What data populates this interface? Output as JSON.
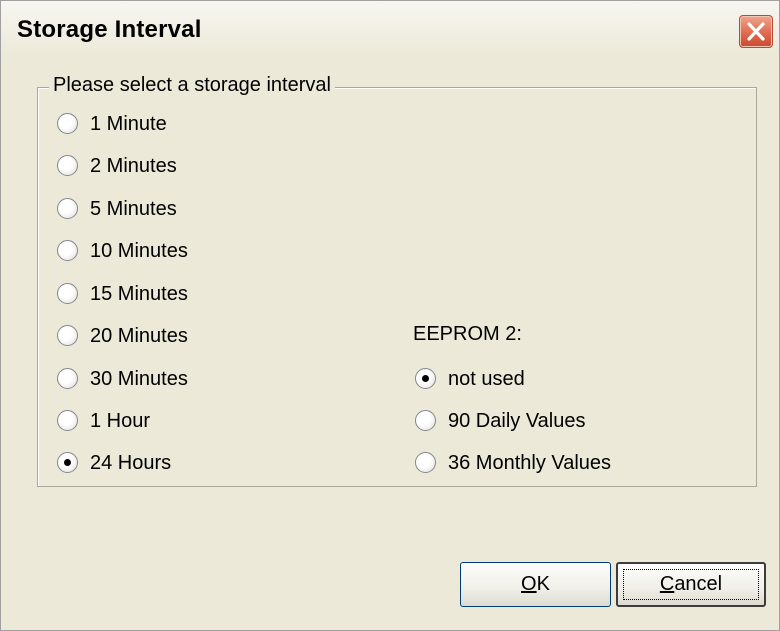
{
  "window": {
    "title": "Storage Interval",
    "close_icon": "close-icon"
  },
  "group": {
    "label": "Please select a storage interval"
  },
  "intervals": [
    {
      "label": "1 Minute",
      "checked": false
    },
    {
      "label": "2 Minutes",
      "checked": false
    },
    {
      "label": "5 Minutes",
      "checked": false
    },
    {
      "label": "10 Minutes",
      "checked": false
    },
    {
      "label": "15 Minutes",
      "checked": false
    },
    {
      "label": "20 Minutes",
      "checked": false
    },
    {
      "label": "30 Minutes",
      "checked": false
    },
    {
      "label": "1 Hour",
      "checked": false
    },
    {
      "label": "24 Hours",
      "checked": true
    }
  ],
  "eeprom": {
    "title": "EEPROM 2:",
    "options": [
      {
        "label": "not used",
        "checked": true
      },
      {
        "label": "90 Daily Values",
        "checked": false
      },
      {
        "label": "36 Monthly Values",
        "checked": false
      }
    ]
  },
  "buttons": {
    "ok_mnemonic": "O",
    "ok_rest": "K",
    "cancel_mnemonic": "C",
    "cancel_rest": "ancel"
  },
  "colors": {
    "window_bg": "#ece9d8",
    "close_button": "#e06a4e",
    "button_border": "#003c74"
  }
}
